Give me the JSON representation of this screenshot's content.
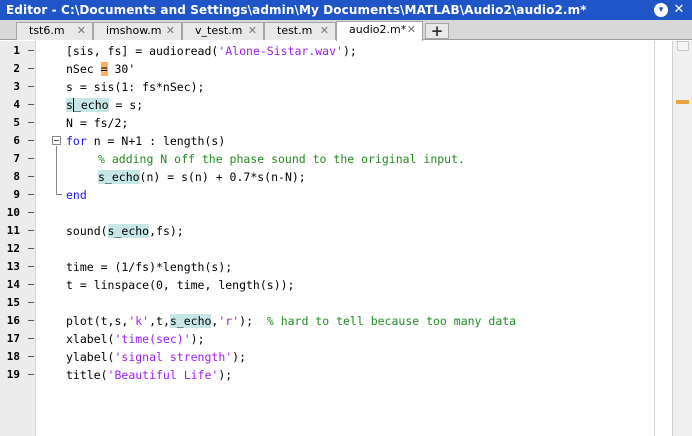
{
  "window": {
    "title": "Editor - C:\\Documents and Settings\\admin\\My Documents\\MATLAB\\Audio2\\audio2.m*"
  },
  "tabs": [
    {
      "label": "tst6.m",
      "active": false
    },
    {
      "label": "imshow.m",
      "active": false
    },
    {
      "label": "v_test.m",
      "active": false
    },
    {
      "label": "test.m",
      "active": false
    },
    {
      "label": "audio2.m*",
      "active": true
    }
  ],
  "tab_close_glyph": "✕",
  "tab_add_glyph": "+",
  "line_numbers": [
    "1",
    "2",
    "3",
    "4",
    "5",
    "6",
    "7",
    "8",
    "9",
    "10",
    "11",
    "12",
    "13",
    "14",
    "15",
    "16",
    "17",
    "18",
    "19"
  ],
  "code": {
    "l1": {
      "a": "[sis, fs] = audioread(",
      "s": "'Alone-Sistar.wav'",
      "b": ");"
    },
    "l2": {
      "a": "nSec ",
      "w": "=",
      "b": " 30'"
    },
    "l3": {
      "a": "s = sis(1: fs*nSec);"
    },
    "l4": {
      "h1": "s",
      "h2": "_echo",
      "b": " = s;"
    },
    "l5": {
      "a": "N = fs/2;"
    },
    "l6": {
      "k": "for",
      "b": " n = N+1 : length(s)"
    },
    "l7": {
      "c": "% adding N off the phase sound to the original input."
    },
    "l8": {
      "h": "s_echo",
      "b": "(n) = s(n) + 0.7*s(n-N);"
    },
    "l9": {
      "k": "end"
    },
    "l11": {
      "a": "sound(",
      "h": "s_echo",
      "b": ",fs);"
    },
    "l13": {
      "a": "time = (1/fs)*length(s);"
    },
    "l14": {
      "a": "t = linspace(0, time, length(s));"
    },
    "l16": {
      "a": "plot(t,s,",
      "s1": "'k'",
      "b": ",t,",
      "h": "s_echo",
      "c2": ",",
      "s2": "'r'",
      "d": ");  ",
      "cm": "% hard to tell because too many data"
    },
    "l17": {
      "a": "xlabel(",
      "s": "'time(sec)'",
      "b": ");"
    },
    "l18": {
      "a": "ylabel(",
      "s": "'signal strength'",
      "b": ");"
    },
    "l19": {
      "a": "title(",
      "s": "'Beautiful Life'",
      "b": ");"
    }
  },
  "colors": {
    "keyword": "#1515ff",
    "string": "#a020f0",
    "comment": "#228b22",
    "highlight": "#c7e6e6",
    "warning": "#ffb05a",
    "titlebar": "#1f55c6"
  },
  "icons": {
    "titlebar_menu": "chevron-down-icon",
    "titlebar_close": "close-icon",
    "fold": "fold-collapse-icon"
  }
}
